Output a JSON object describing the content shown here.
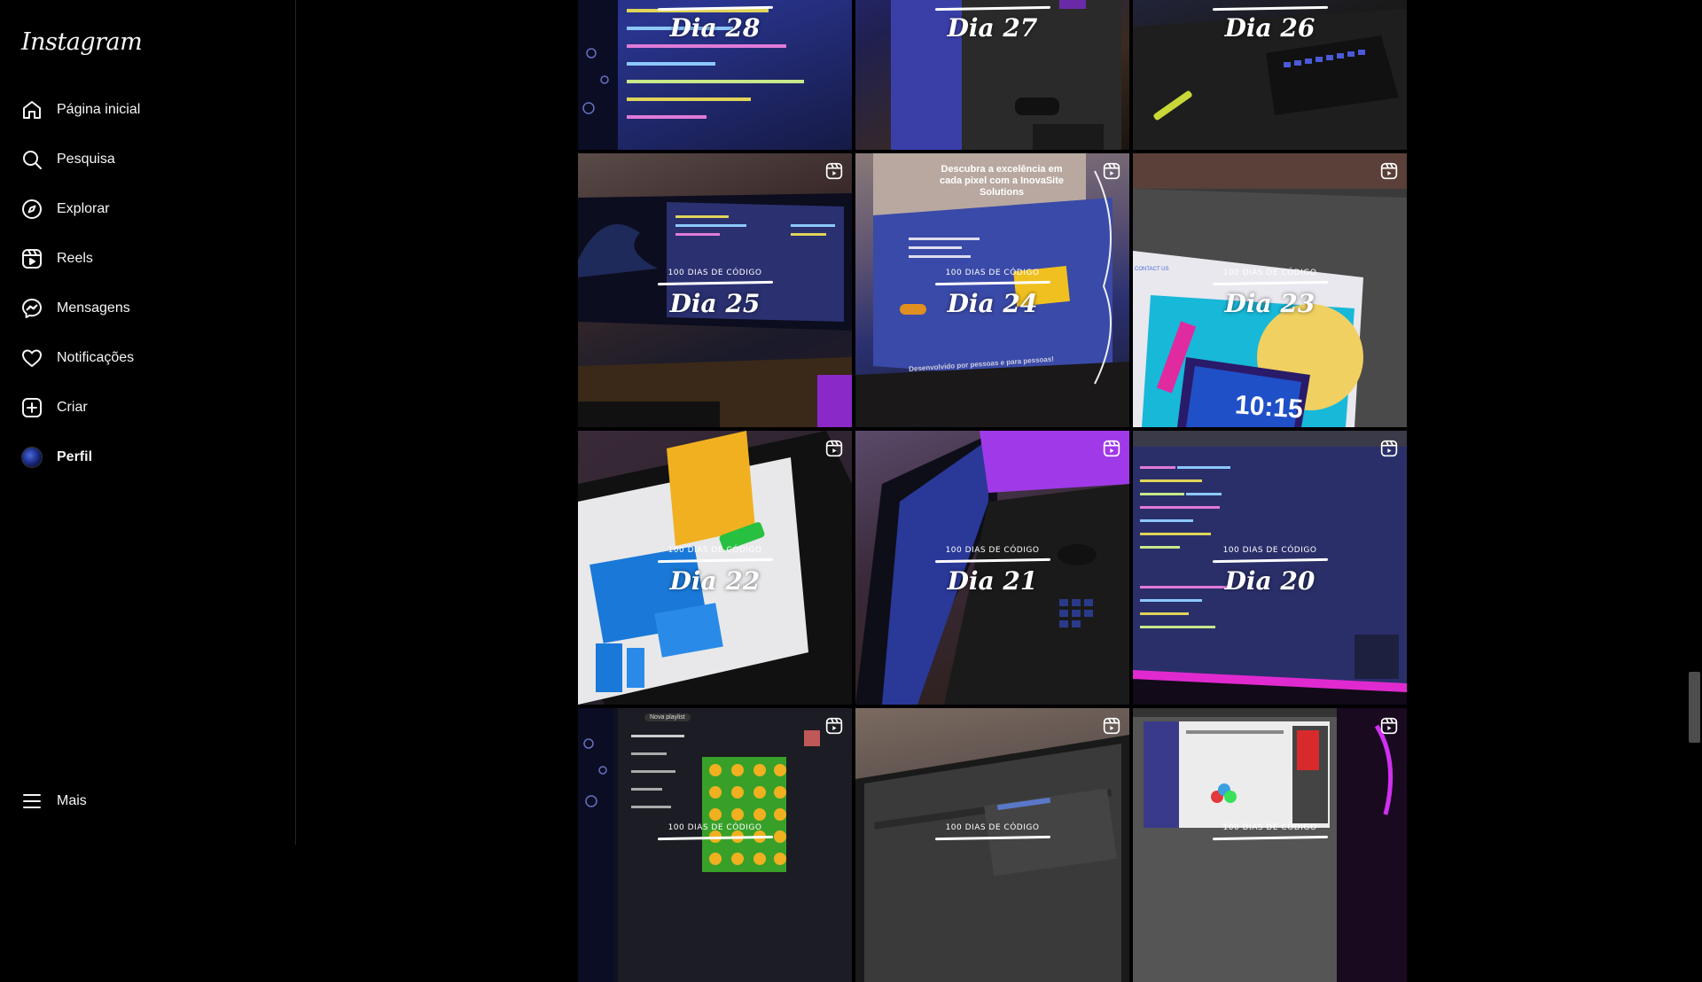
{
  "app": {
    "logo_text": "Instagram"
  },
  "sidebar": {
    "items": [
      {
        "label": "Página inicial",
        "icon": "home-icon"
      },
      {
        "label": "Pesquisa",
        "icon": "search-icon"
      },
      {
        "label": "Explorar",
        "icon": "compass-icon"
      },
      {
        "label": "Reels",
        "icon": "reels-icon"
      },
      {
        "label": "Mensagens",
        "icon": "messenger-icon"
      },
      {
        "label": "Notificações",
        "icon": "heart-icon"
      },
      {
        "label": "Criar",
        "icon": "plus-square-icon"
      },
      {
        "label": "Perfil",
        "icon": "avatar"
      }
    ],
    "more_label": "Mais"
  },
  "feed": {
    "series_caption": "100 DIAS DE CÓDIGO",
    "tiles": [
      {
        "day": "Dia 28",
        "reel": false
      },
      {
        "day": "Dia 27",
        "reel": false
      },
      {
        "day": "Dia 26",
        "reel": false
      },
      {
        "day": "Dia 25",
        "reel": true
      },
      {
        "day": "Dia 24",
        "reel": true
      },
      {
        "day": "Dia 23",
        "reel": true
      },
      {
        "day": "Dia 22",
        "reel": true
      },
      {
        "day": "Dia 21",
        "reel": true
      },
      {
        "day": "Dia 20",
        "reel": true
      },
      {
        "day": "",
        "reel": true
      },
      {
        "day": "",
        "reel": true
      },
      {
        "day": "",
        "reel": true
      }
    ],
    "tile_texts": {
      "dia24_headline": "Descubra a excelência em cada pixel com a InovaSite Solutions",
      "dia24_footer": "Desenvolvido por pessoas e para pessoas!",
      "dia23_clock": "10:15",
      "dia23_nav": "CONTACT US",
      "row4_playlist": "Nova playlist"
    }
  },
  "colors": {
    "background": "#000000",
    "text": "#f5f5f5",
    "border": "#262626",
    "accent_purple": "#a020f0"
  }
}
